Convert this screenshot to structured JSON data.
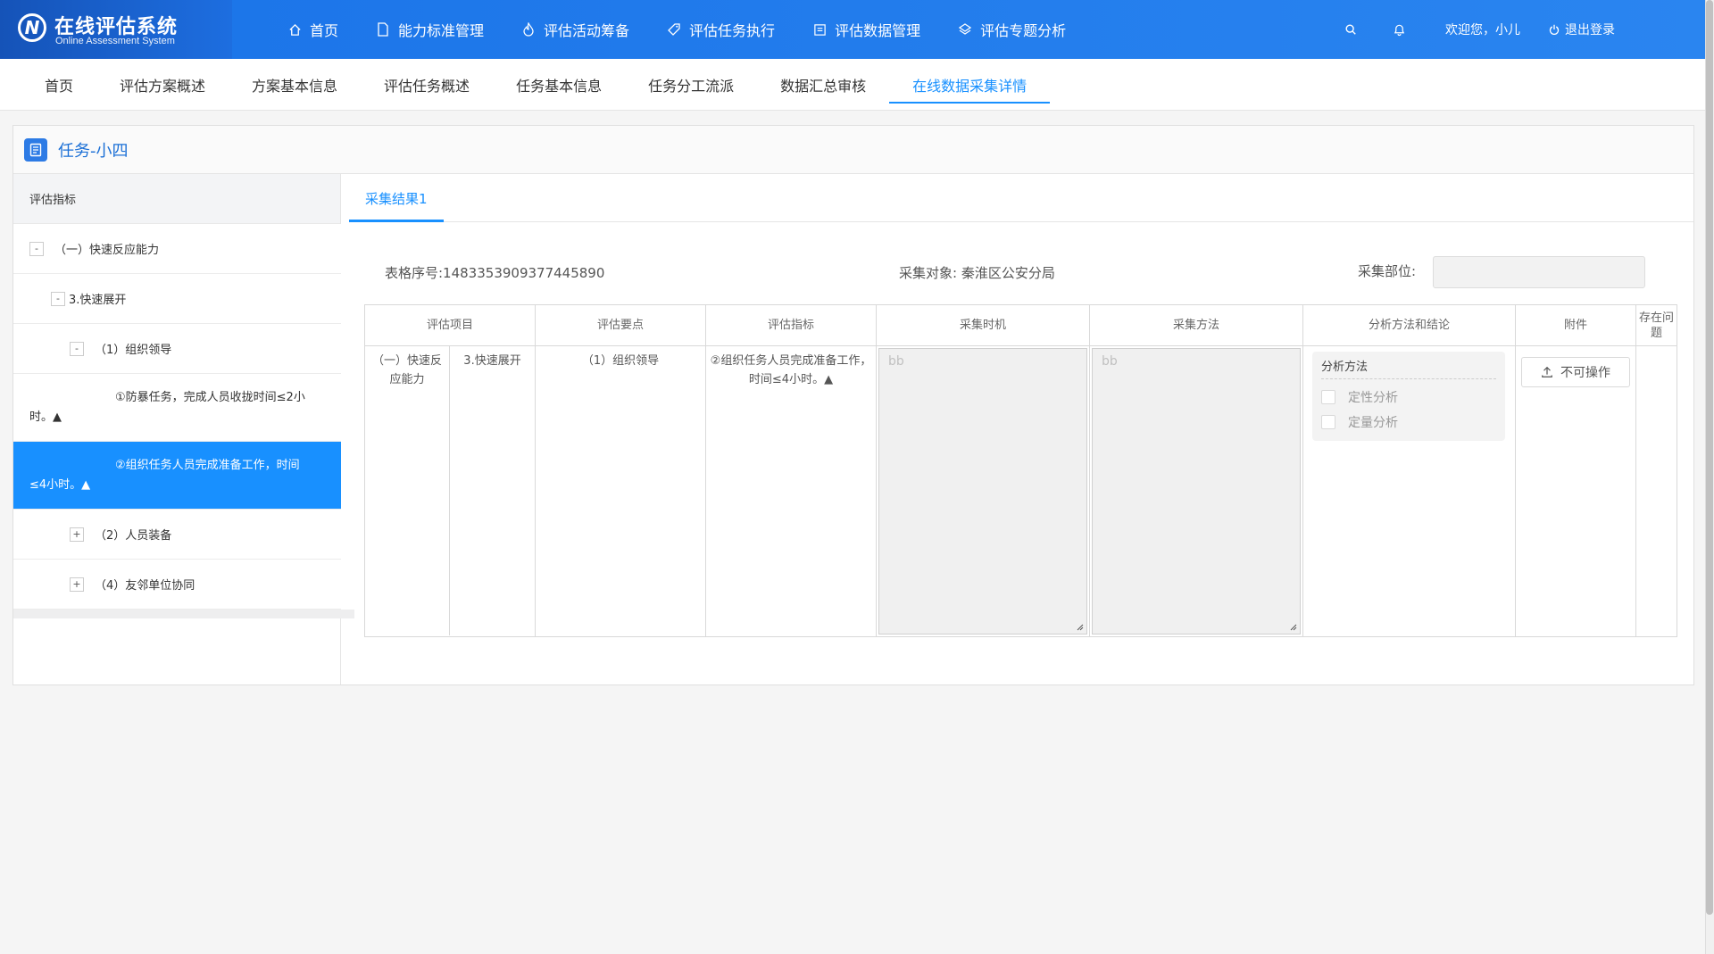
{
  "app": {
    "logo_title": "在线评估系统",
    "logo_subtitle": "Online Assessment System",
    "logo_letter": "N"
  },
  "nav": [
    {
      "label": "首页",
      "icon": "home-icon"
    },
    {
      "label": "能力标准管理",
      "icon": "document-icon"
    },
    {
      "label": "评估活动筹备",
      "icon": "flame-icon"
    },
    {
      "label": "评估任务执行",
      "icon": "tag-icon"
    },
    {
      "label": "评估数据管理",
      "icon": "data-icon"
    },
    {
      "label": "评估专题分析",
      "icon": "layers-icon"
    }
  ],
  "user": {
    "welcome": "欢迎您，小儿",
    "logout": "退出登录"
  },
  "subtabs": [
    {
      "label": "首页",
      "active": false
    },
    {
      "label": "评估方案概述",
      "active": false
    },
    {
      "label": "方案基本信息",
      "active": false
    },
    {
      "label": "评估任务概述",
      "active": false
    },
    {
      "label": "任务基本信息",
      "active": false
    },
    {
      "label": "任务分工流派",
      "active": false
    },
    {
      "label": "数据汇总审核",
      "active": false
    },
    {
      "label": "在线数据采集详情",
      "active": true
    }
  ],
  "panel": {
    "title": "任务-小四"
  },
  "tree": {
    "header": "评估指标",
    "nodes": [
      {
        "toggle": "-",
        "label": "（一）快速反应能力"
      },
      {
        "toggle": "-",
        "label": "3.快速展开"
      },
      {
        "toggle": "-",
        "label": "（1）组织领导"
      },
      {
        "label": "①防暴任务，完成人员收拢时间≤2小时。▲"
      },
      {
        "label": "②组织任务人员完成准备工作，时间≤4小时。▲",
        "selected": true
      },
      {
        "toggle": "+",
        "label": "（2）人员装备"
      },
      {
        "toggle": "+",
        "label": "（4）友邻单位协同"
      }
    ]
  },
  "result": {
    "tab": "采集结果1",
    "serial_label": "表格序号:1483353909377445890",
    "target_label": "采集对象: 秦淮区公安分局",
    "part_label": "采集部位:",
    "columns": [
      "评估项目",
      "评估要点",
      "评估指标",
      "采集时机",
      "采集方法",
      "分析方法和结论",
      "附件",
      "存在问题"
    ],
    "row": {
      "project_a": "（一）快速反应能力",
      "project_b": "3.快速展开",
      "point": "（1）组织领导",
      "indicator": "②组织任务人员完成准备工作，时间≤4小时。▲",
      "timing": "bb",
      "method": "bb",
      "analysis_title": "分析方法",
      "analysis_options": [
        "定性分析",
        "定量分析"
      ],
      "attachment_button": "不可操作"
    }
  }
}
